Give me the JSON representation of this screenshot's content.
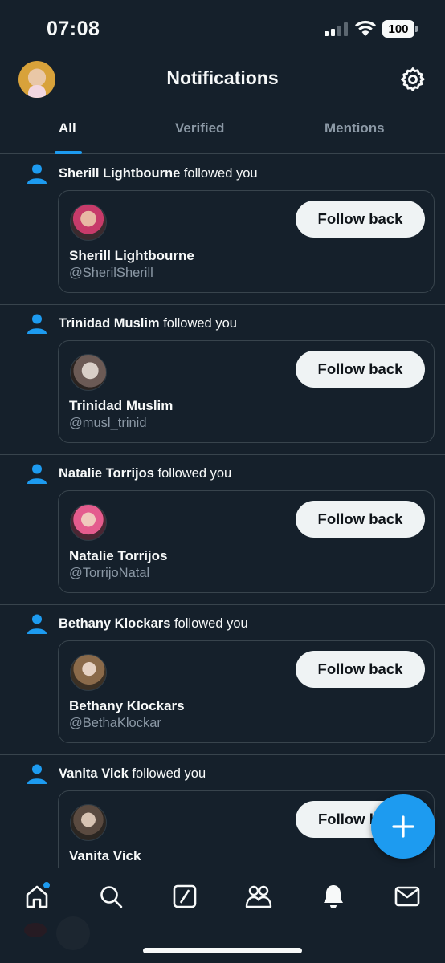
{
  "status_bar": {
    "time": "07:08",
    "battery": "100"
  },
  "header": {
    "title": "Notifications"
  },
  "tabs": [
    {
      "label": "All",
      "active": true
    },
    {
      "label": "Verified",
      "active": false
    },
    {
      "label": "Mentions",
      "active": false
    }
  ],
  "notifications": [
    {
      "actor": "Sherill Lightbourne",
      "action": " followed you",
      "name": "Sherill Lightbourne",
      "handle": "@SherilSherill",
      "button": "Follow back"
    },
    {
      "actor": "Trinidad Muslim",
      "action": " followed you",
      "name": "Trinidad Muslim",
      "handle": "@musl_trinid",
      "button": "Follow back"
    },
    {
      "actor": "Natalie Torrijos",
      "action": " followed you",
      "name": "Natalie Torrijos",
      "handle": "@TorrijoNatal",
      "button": "Follow back"
    },
    {
      "actor": "Bethany Klockars",
      "action": " followed you",
      "name": "Bethany Klockars",
      "handle": "@BethaKlockar",
      "button": "Follow back"
    },
    {
      "actor": "Vanita Vick",
      "action": " followed you",
      "name": "Vanita Vick",
      "handle": "",
      "button": "Follow b"
    }
  ],
  "bottom_nav": [
    {
      "icon": "home-icon",
      "has_dot": true
    },
    {
      "icon": "search-icon",
      "has_dot": false
    },
    {
      "icon": "grok-icon",
      "has_dot": false
    },
    {
      "icon": "communities-icon",
      "has_dot": false
    },
    {
      "icon": "bell-icon",
      "has_dot": false
    },
    {
      "icon": "mail-icon",
      "has_dot": false
    }
  ],
  "colors": {
    "background": "#15202b",
    "accent": "#1d9bf0",
    "divider": "#38444d",
    "muted": "#8b98a5"
  }
}
